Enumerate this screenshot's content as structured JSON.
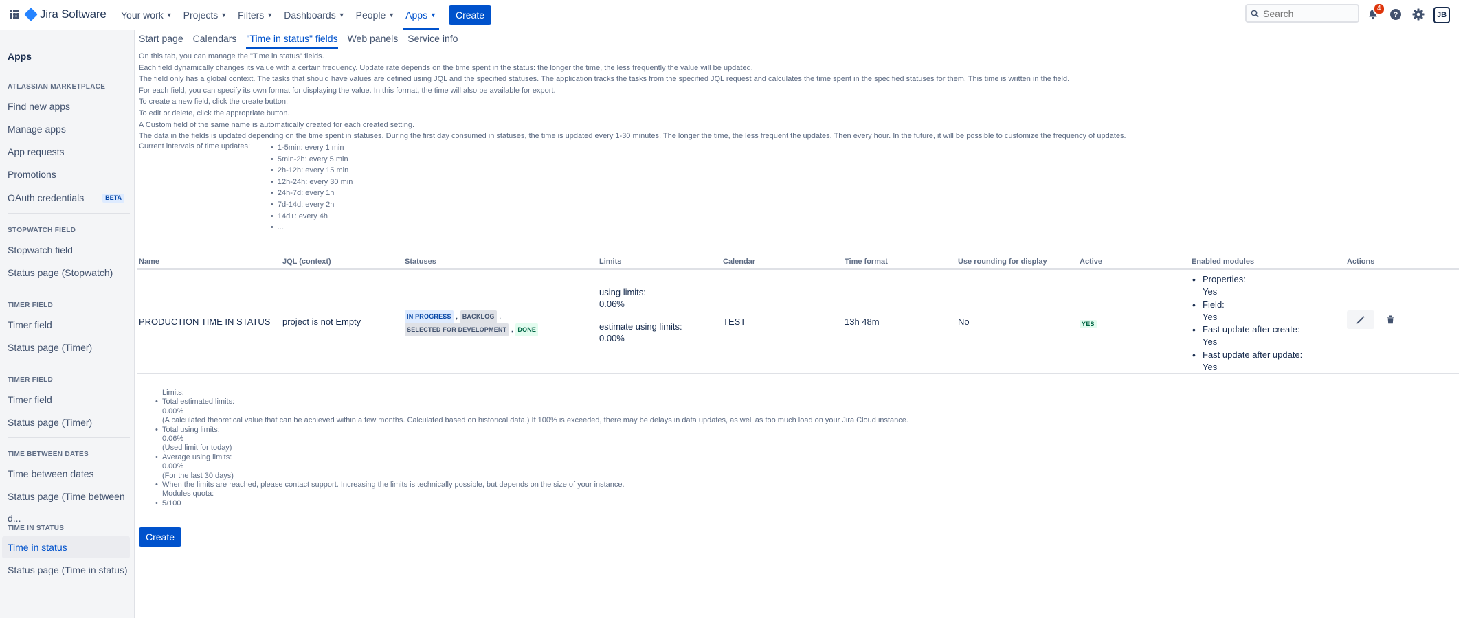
{
  "topnav": {
    "product_name": "Jira Software",
    "items": [
      {
        "label": "Your work"
      },
      {
        "label": "Projects"
      },
      {
        "label": "Filters"
      },
      {
        "label": "Dashboards"
      },
      {
        "label": "People"
      },
      {
        "label": "Apps"
      }
    ],
    "active_item": "Apps",
    "create_label": "Create",
    "search_placeholder": "Search",
    "notification_count": "4",
    "avatar_initials": "JB"
  },
  "sidebar": {
    "title": "Apps",
    "sections": [
      {
        "heading": "ATLASSIAN MARKETPLACE",
        "items": [
          {
            "label": "Find new apps"
          },
          {
            "label": "Manage apps"
          },
          {
            "label": "App requests"
          },
          {
            "label": "Promotions"
          },
          {
            "label": "OAuth credentials",
            "badge": "BETA"
          }
        ]
      },
      {
        "heading": "STOPWATCH FIELD",
        "items": [
          {
            "label": "Stopwatch field"
          },
          {
            "label": "Status page (Stopwatch)"
          }
        ]
      },
      {
        "heading": "TIMER FIELD",
        "items": [
          {
            "label": "Timer field"
          },
          {
            "label": "Status page (Timer)"
          }
        ]
      },
      {
        "heading": "TIMER FIELD",
        "items": [
          {
            "label": "Timer field"
          },
          {
            "label": "Status page (Timer)"
          }
        ]
      },
      {
        "heading": "TIME BETWEEN DATES",
        "items": [
          {
            "label": "Time between dates"
          },
          {
            "label": "Status page (Time between d..."
          }
        ]
      },
      {
        "heading": "TIME IN STATUS",
        "items": [
          {
            "label": "Time in status"
          },
          {
            "label": "Status page (Time in status)"
          }
        ]
      }
    ],
    "selected_item": "Time in status"
  },
  "tabs": [
    {
      "label": "Start page"
    },
    {
      "label": "Calendars"
    },
    {
      "label": "\"Time in status\" fields"
    },
    {
      "label": "Web panels"
    },
    {
      "label": "Service info"
    }
  ],
  "active_tab": "\"Time in status\" fields",
  "intro_lines": [
    "On this tab, you can manage the \"Time in status\" fields.",
    "Each field dynamically changes its value with a certain frequency. Update rate depends on the time spent in the status: the longer the time, the less frequently the value will be updated.",
    "The field only has a global context. The tasks that should have values are defined using JQL and the specified statuses. The application tracks the tasks from the specified JQL request and calculates the time spent in the specified statuses for them. This time is written in the field.",
    "For each field, you can specify its own format for displaying the value. In this format, the time will also be available for export.",
    "To create a new field, click the create button.",
    "To edit or delete, click the appropriate button.",
    "A Custom field of the same name is automatically created for each created setting.",
    "The data in the fields is updated depending on the time spent in statuses. During the first day consumed in statuses, the time is updated every 1-30 minutes. The longer the time, the less frequent the updates. Then every hour. In the future, it will be possible to customize the frequency of updates."
  ],
  "intervals_label": "Current intervals of time updates:",
  "intervals": [
    "1-5min: every 1 min",
    "5min-2h: every 5 min",
    "2h-12h: every 15 min",
    "12h-24h: every 30 min",
    "24h-7d: every 1h",
    "7d-14d: every 2h",
    "14d+: every 4h",
    "..."
  ],
  "table": {
    "headers": [
      "Name",
      "JQL (context)",
      "Statuses",
      "Limits",
      "Calendar",
      "Time format",
      "Use rounding for display",
      "Active",
      "Enabled modules",
      "Actions"
    ],
    "row": {
      "name": "PRODUCTION TIME IN STATUS",
      "jql": "project is not Empty",
      "statuses": [
        {
          "label": "IN PROGRESS",
          "color": "#0747a6"
        },
        {
          "label": "BACKLOG",
          "color": "#42526e"
        },
        {
          "label": "SELECTED FOR DEVELOPMENT",
          "color": "#42526e"
        },
        {
          "label": "DONE",
          "color": "#006644"
        }
      ],
      "limits_using_label": "using limits:",
      "limits_using_value": "0.06%",
      "limits_estimate_label": "estimate using limits:",
      "limits_estimate_value": "0.00%",
      "calendar": "TEST",
      "time_format": "13h 48m",
      "rounding": "No",
      "active": "YES",
      "modules": [
        {
          "label": "Properties:",
          "value": "Yes"
        },
        {
          "label": "Field:",
          "value": "Yes"
        },
        {
          "label": "Fast update after create:",
          "value": "Yes"
        },
        {
          "label": "Fast update after update:",
          "value": "Yes"
        }
      ]
    }
  },
  "limits_info": {
    "heading": "Limits:",
    "total_estimated_label": "Total estimated limits:",
    "total_estimated_value": "0.00%",
    "total_estimated_note": "(A calculated theoretical value that can be achieved within a few months. Calculated based on historical data.) If 100% is exceeded, there may be delays in data updates, as well as too much load on your Jira Cloud instance.",
    "total_using_label": "Total using limits:",
    "total_using_value": "0.06%",
    "total_using_note": "(Used limit for today)",
    "average_label": "Average using limits:",
    "average_value": "0.00%",
    "average_note": "(For the last 30 days)",
    "contact_note": "When the limits are reached, please contact support. Increasing the limits is technically possible, but depends on the size of your instance.",
    "quota_label": "Modules quota:",
    "quota_value": "5/100"
  },
  "create_button_label": "Create"
}
